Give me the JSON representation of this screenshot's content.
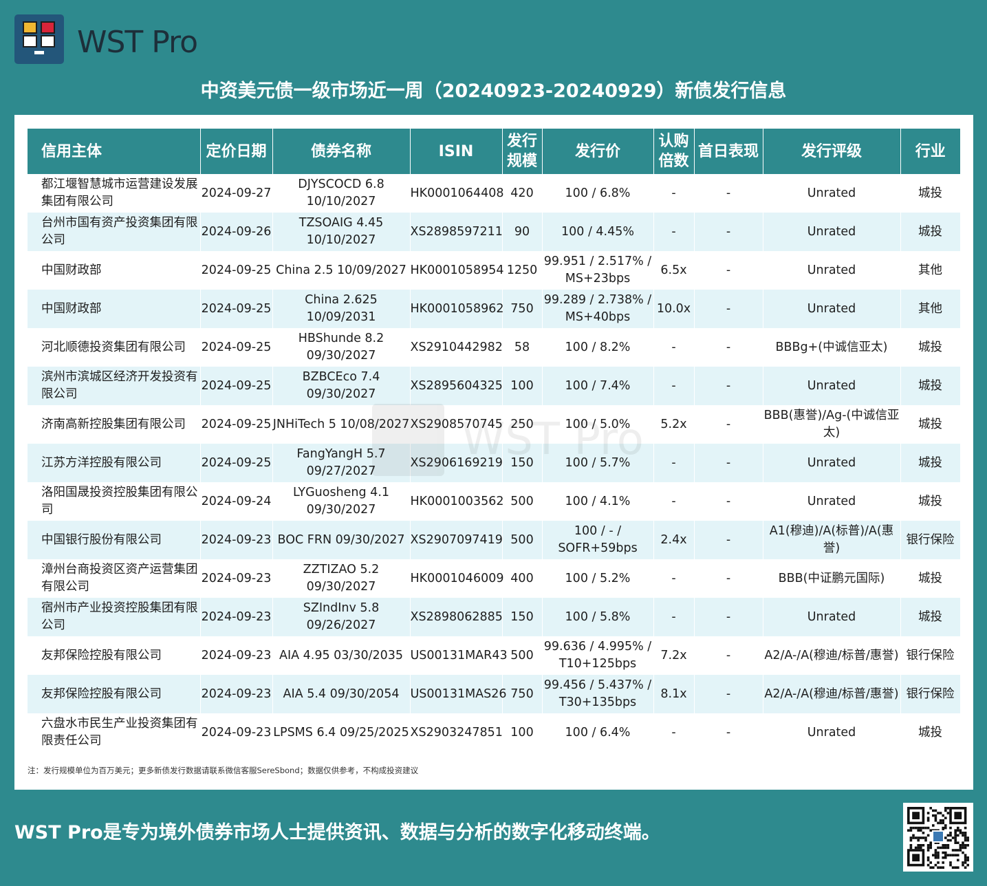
{
  "brand": {
    "name": "WST Pro"
  },
  "title": "中资美元债一级市场近一周（20240923-20240929）新债发行信息",
  "table": {
    "headers": [
      "信用主体",
      "定价日期",
      "债券名称",
      "ISIN",
      "发行\n规模",
      "发行价",
      "认购\n倍数",
      "首日表现",
      "发行评级",
      "行业"
    ],
    "rows": [
      [
        "都江堰智慧城市运营建设发展集团有限公司",
        "2024-09-27",
        "DJYSCOCD 6.8 10/10/2027",
        "HK0001064408",
        "420",
        "100 / 6.8%",
        "-",
        "-",
        "Unrated",
        "城投"
      ],
      [
        "台州市国有资产投资集团有限公司",
        "2024-09-26",
        "TZSOAIG 4.45 10/10/2027",
        "XS2898597211",
        "90",
        "100 / 4.45%",
        "-",
        "-",
        "Unrated",
        "城投"
      ],
      [
        "中国财政部",
        "2024-09-25",
        "China 2.5 10/09/2027",
        "HK0001058954",
        "1250",
        "99.951 / 2.517% / MS+23bps",
        "6.5x",
        "-",
        "Unrated",
        "其他"
      ],
      [
        "中国财政部",
        "2024-09-25",
        "China 2.625 10/09/2031",
        "HK0001058962",
        "750",
        "99.289 / 2.738% / MS+40bps",
        "10.0x",
        "-",
        "Unrated",
        "其他"
      ],
      [
        "河北顺德投资集团有限公司",
        "2024-09-25",
        "HBShunde 8.2 09/30/2027",
        "XS2910442982",
        "58",
        "100 / 8.2%",
        "-",
        "-",
        "BBBg+(中诚信亚太)",
        "城投"
      ],
      [
        "滨州市滨城区经济开发投资有限公司",
        "2024-09-25",
        "BZBCEco 7.4 09/30/2027",
        "XS2895604325",
        "100",
        "100 / 7.4%",
        "-",
        "-",
        "Unrated",
        "城投"
      ],
      [
        "济南高新控股集团有限公司",
        "2024-09-25",
        "JNHiTech 5 10/08/2027",
        "XS2908570745",
        "250",
        "100 / 5.0%",
        "5.2x",
        "-",
        "BBB(惠誉)/Ag-(中诚信亚太)",
        "城投"
      ],
      [
        "江苏方洋控股有限公司",
        "2024-09-25",
        "FangYangH 5.7 09/27/2027",
        "XS2906169219",
        "150",
        "100 / 5.7%",
        "-",
        "-",
        "Unrated",
        "城投"
      ],
      [
        "洛阳国晟投资控股集团有限公司",
        "2024-09-24",
        "LYGuosheng 4.1 09/30/2027",
        "HK0001003562",
        "500",
        "100 / 4.1%",
        "-",
        "-",
        "Unrated",
        "城投"
      ],
      [
        "中国银行股份有限公司",
        "2024-09-23",
        "BOC FRN 09/30/2027",
        "XS2907097419",
        "500",
        "100 / - / SOFR+59bps",
        "2.4x",
        "-",
        "A1(穆迪)/A(标普)/A(惠誉)",
        "银行保险"
      ],
      [
        "漳州台商投资区资产运营集团有限公司",
        "2024-09-23",
        "ZZTIZAO 5.2 09/30/2027",
        "HK0001046009",
        "400",
        "100 / 5.2%",
        "-",
        "-",
        "BBB(中证鹏元国际)",
        "城投"
      ],
      [
        "宿州市产业投资控股集团有限公司",
        "2024-09-23",
        "SZIndInv 5.8 09/26/2027",
        "XS2898062885",
        "150",
        "100 / 5.8%",
        "-",
        "-",
        "Unrated",
        "城投"
      ],
      [
        "友邦保险控股有限公司",
        "2024-09-23",
        "AIA 4.95 03/30/2035",
        "US00131MAR43",
        "500",
        "99.636 / 4.995% / T10+125bps",
        "7.2x",
        "-",
        "A2/A-/A(穆迪/标普/惠誉)",
        "银行保险"
      ],
      [
        "友邦保险控股有限公司",
        "2024-09-23",
        "AIA 5.4 09/30/2054",
        "US00131MAS26",
        "750",
        "99.456 / 5.437% / T30+135bps",
        "8.1x",
        "-",
        "A2/A-/A(穆迪/标普/惠誉)",
        "银行保险"
      ],
      [
        "六盘水市民生产业投资集团有限责任公司",
        "2024-09-23",
        "LPSMS 6.4 09/25/2025",
        "XS2903247851",
        "100",
        "100 / 6.4%",
        "-",
        "-",
        "Unrated",
        "城投"
      ]
    ]
  },
  "note": "注：发行规模单位为百万美元；更多新债发行数据请联系微信客服SereSbond；数据仅供参考，不构成投资建议",
  "footer": "WST Pro是专为境外债券市场人士提供资讯、数据与分析的数字化移动终端。"
}
